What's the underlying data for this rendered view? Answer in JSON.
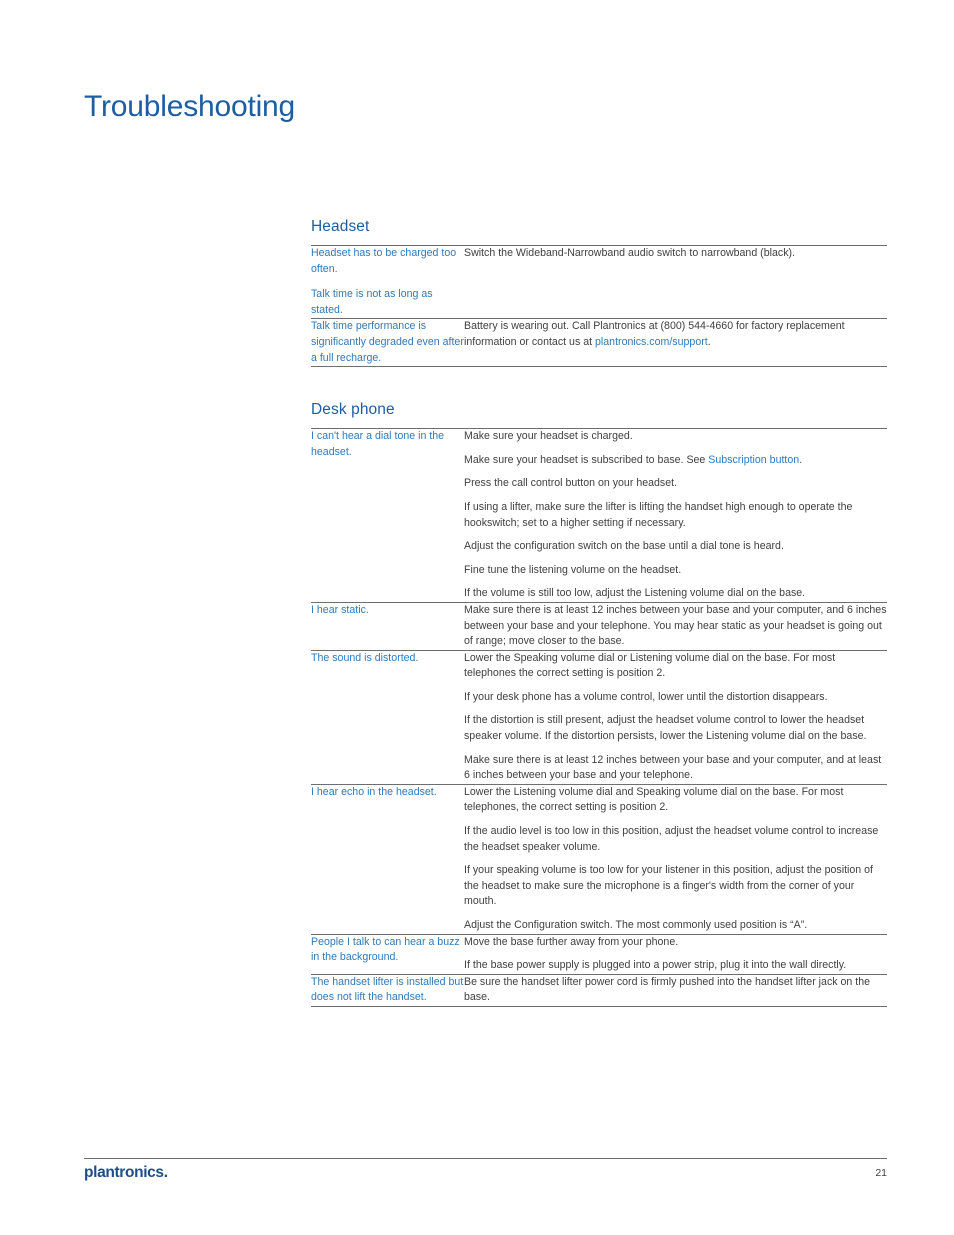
{
  "document": {
    "title": "Troubleshooting",
    "page_number": "21",
    "brand_logo": "plantronics",
    "brand_logo_suffix": ".",
    "colors": {
      "title_blue": "#1d5da4",
      "heading_blue": "#1d5da4",
      "link_blue": "#2c7ac0",
      "body_gray": "#414042",
      "rule_gray": "#6d6e70",
      "logo_navy": "#1c4e88"
    }
  },
  "sections": [
    {
      "heading": "Headset",
      "rows": [
        {
          "questions": [
            "Headset has to be charged too often.",
            "Talk time is not as long as stated."
          ],
          "answers": [
            {
              "parts": [
                {
                  "text": "Switch the Wideband-Narrowband audio switch to narrowband (black).",
                  "link": false
                }
              ]
            }
          ]
        },
        {
          "questions": [
            "Talk time performance is significantly degraded even after a full recharge."
          ],
          "answers": [
            {
              "parts": [
                {
                  "text": "Battery is wearing out. Call Plantronics at (800) 544-4660 for factory replacement information or contact us at ",
                  "link": false
                },
                {
                  "text": "plantronics.com/support",
                  "link": true
                },
                {
                  "text": ".",
                  "link": false
                }
              ]
            }
          ]
        }
      ]
    },
    {
      "heading": "Desk phone",
      "rows": [
        {
          "questions": [
            "I can't hear a dial tone in the headset."
          ],
          "answers": [
            {
              "parts": [
                {
                  "text": "Make sure your headset is charged.",
                  "link": false
                }
              ]
            },
            {
              "parts": [
                {
                  "text": "Make sure your headset is subscribed to base. See ",
                  "link": false
                },
                {
                  "text": "Subscription button",
                  "link": true
                },
                {
                  "text": ".",
                  "link": false
                }
              ]
            },
            {
              "parts": [
                {
                  "text": "Press the call control button on your headset.",
                  "link": false
                }
              ]
            },
            {
              "parts": [
                {
                  "text": "If using a lifter, make sure the lifter is lifting the handset high enough to operate the hookswitch; set to a higher setting if necessary.",
                  "link": false
                }
              ]
            },
            {
              "parts": [
                {
                  "text": "Adjust the configuration switch on the base until a dial tone is heard.",
                  "link": false
                }
              ]
            },
            {
              "parts": [
                {
                  "text": "Fine tune the listening volume on the headset.",
                  "link": false
                }
              ]
            },
            {
              "parts": [
                {
                  "text": "If the volume is still too low, adjust the Listening volume dial on the base.",
                  "link": false
                }
              ]
            }
          ]
        },
        {
          "questions": [
            "I hear static."
          ],
          "answers": [
            {
              "parts": [
                {
                  "text": "Make sure there is at least 12 inches between your base and your computer, and 6 inches between your base and your telephone. You may hear static as your headset is going out of range; move closer to the base.",
                  "link": false
                }
              ]
            }
          ]
        },
        {
          "questions": [
            "The sound is distorted."
          ],
          "answers": [
            {
              "parts": [
                {
                  "text": "Lower the Speaking volume dial or Listening volume dial on the base. For most telephones the correct setting is position 2.",
                  "link": false
                }
              ]
            },
            {
              "parts": [
                {
                  "text": "If your desk phone has a volume control, lower until the distortion disappears.",
                  "link": false
                }
              ]
            },
            {
              "parts": [
                {
                  "text": "If the distortion is still present, adjust the headset volume control to lower the headset speaker volume.  If the distortion persists, lower the Listening volume dial on the base.",
                  "link": false
                }
              ]
            },
            {
              "parts": [
                {
                  "text": "Make sure there is at least 12 inches between your base and your computer, and at least 6 inches between your base and your telephone.",
                  "link": false
                }
              ]
            }
          ]
        },
        {
          "questions": [
            "I hear echo in the headset."
          ],
          "answers": [
            {
              "parts": [
                {
                  "text": "Lower the Listening volume dial and Speaking volume dial on the base. For most telephones, the correct setting is position 2.",
                  "link": false
                }
              ]
            },
            {
              "parts": [
                {
                  "text": "If the audio level is too low in this position, adjust the headset volume control to increase the headset speaker volume.",
                  "link": false
                }
              ]
            },
            {
              "parts": [
                {
                  "text": "If your speaking volume is too low for your listener in this position, adjust the position of the headset to make sure the microphone is a finger's width from the corner of your mouth.",
                  "link": false
                }
              ]
            },
            {
              "parts": [
                {
                  "text": "Adjust the Configuration switch. The most commonly used position is “A”.",
                  "link": false
                }
              ]
            }
          ]
        },
        {
          "questions": [
            "People I talk to can hear a buzz in the background."
          ],
          "answers": [
            {
              "parts": [
                {
                  "text": "Move the base further away from your phone.",
                  "link": false
                }
              ]
            },
            {
              "parts": [
                {
                  "text": "If the base power supply is plugged into a power strip, plug it into the wall directly.",
                  "link": false
                }
              ]
            }
          ]
        },
        {
          "questions": [
            "The handset lifter is installed but does not lift the handset."
          ],
          "answers": [
            {
              "parts": [
                {
                  "text": "Be sure the handset lifter power cord is firmly pushed into the handset lifter jack on the base.",
                  "link": false
                }
              ]
            }
          ]
        }
      ]
    }
  ]
}
